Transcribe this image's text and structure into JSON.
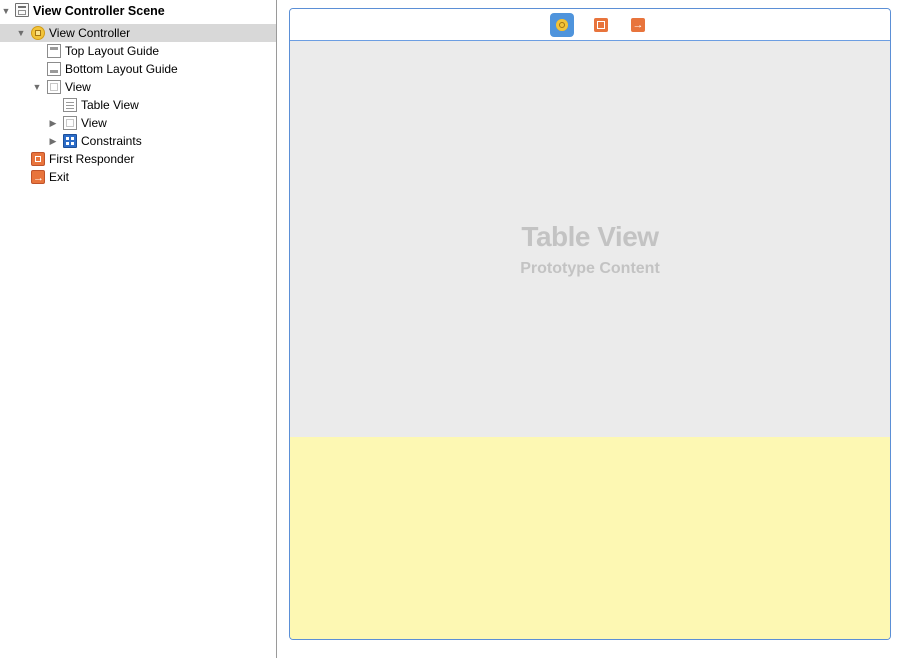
{
  "outline": {
    "scene": "View Controller Scene",
    "view_controller": "View Controller",
    "top_layout_guide": "Top Layout Guide",
    "bottom_layout_guide": "Bottom Layout Guide",
    "view": "View",
    "table_view": "Table View",
    "sub_view": "View",
    "constraints": "Constraints",
    "first_responder": "First Responder",
    "exit": "Exit"
  },
  "canvas": {
    "table_view_title": "Table View",
    "table_view_subtitle": "Prototype Content",
    "dock_icons": [
      "view-controller-icon",
      "first-responder-icon",
      "exit-icon"
    ],
    "colors": {
      "table_background": "#ebebeb",
      "yellow_view": "#fdf8b3",
      "selection_border": "#5b8fd6"
    }
  }
}
